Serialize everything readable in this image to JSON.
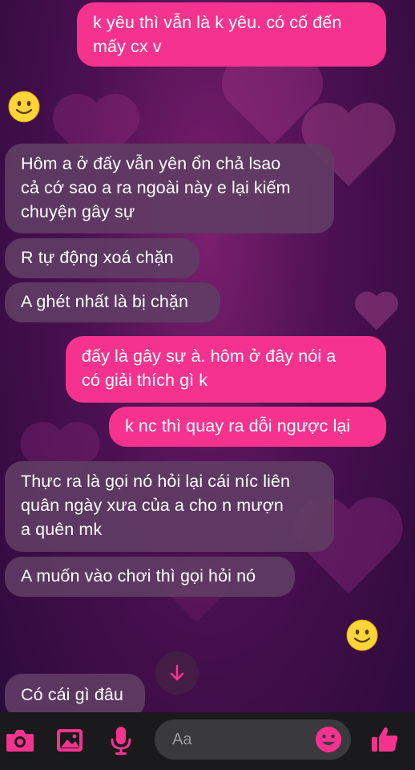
{
  "messages": [
    {
      "side": "sent",
      "text": "k yêu thì vẫn là k yêu. có cố đến mấy cx v"
    },
    {
      "side": "recv",
      "text": "Hôm a ở đấy vẫn yên ổn chả lsao cả cớ sao a ra ngoài này e lại kiếm chuyện gây sự"
    },
    {
      "side": "recv",
      "text": "R tự động xoá chặn"
    },
    {
      "side": "recv",
      "text": "A ghét nhất là bị chặn"
    },
    {
      "side": "sent",
      "text": "đấy là gây sự à. hôm ở đây nói a có giải thích gì k"
    },
    {
      "side": "sent",
      "text": "k nc thì quay ra dỗi ngược lại"
    },
    {
      "side": "recv",
      "text": "Thực ra là gọi nó hỏi lại cái níc liên quân ngày xưa của a cho n mượn a quên mk"
    },
    {
      "side": "recv",
      "text": "A muốn vào chơi thì gọi hỏi nó"
    },
    {
      "side": "recv",
      "text": "Có cái gì đâu"
    }
  ],
  "msg_lines": {
    "m0": [
      "k yêu thì vẫn là k yêu. có cố đến",
      "mấy cx v"
    ],
    "m1": [
      "Hôm a ở đấy vẫn yên ổn chả lsao",
      "cả cớ sao a ra ngoài này e lại kiếm",
      "chuyện gây sự"
    ],
    "m4": [
      "đấy là gây sự à. hôm ở đây nói a",
      "có giải thích gì k"
    ],
    "m6": [
      "Thực ra là gọi nó hỏi lại cái níc liên",
      "quân ngày xưa của a cho n mượn",
      "a quên mk"
    ]
  },
  "composer": {
    "placeholder": "Aa"
  },
  "icons": [
    "camera-icon",
    "gallery-icon",
    "microphone-icon",
    "emoji-icon",
    "thumbs-up-icon",
    "arrow-down-icon",
    "smiley-reaction-icon"
  ],
  "colors": {
    "sent_bubble": "#f5338f",
    "recv_bubble": "#5f3c64",
    "accent": "#f5338f",
    "bottom_bar": "#1a1a1c"
  }
}
